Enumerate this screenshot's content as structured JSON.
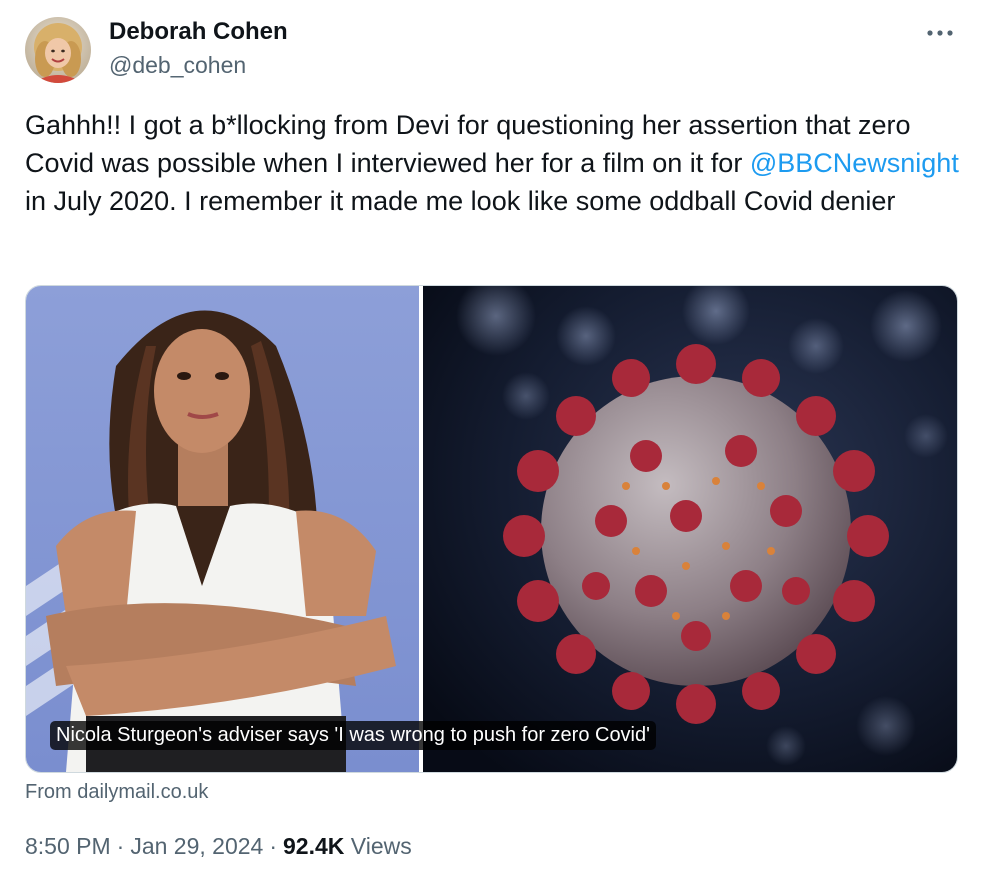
{
  "author": {
    "name": "Deborah Cohen",
    "handle": "@deb_cohen"
  },
  "tweet": {
    "text_before": "Gahhh!! I got a b*llocking from Devi for questioning her assertion that zero Covid was possible when I interviewed her for a film on it for ",
    "mention": "@BBCNewsnight",
    "text_after": " in July 2020. I remember it made me look like some oddball Covid denier"
  },
  "card": {
    "headline": "Nicola Sturgeon's adviser says 'I was wrong to push for zero Covid'",
    "source": "From dailymail.co.uk"
  },
  "meta": {
    "time": "8:50 PM",
    "separator": "·",
    "date": "Jan 29, 2024",
    "views_count": "92.4K",
    "views_label": "Views"
  },
  "icons": {
    "more": "more-horizontal-icon"
  },
  "colors": {
    "link": "#1d9bf0",
    "secondary_text": "#536471",
    "primary_text": "#0f1419"
  }
}
